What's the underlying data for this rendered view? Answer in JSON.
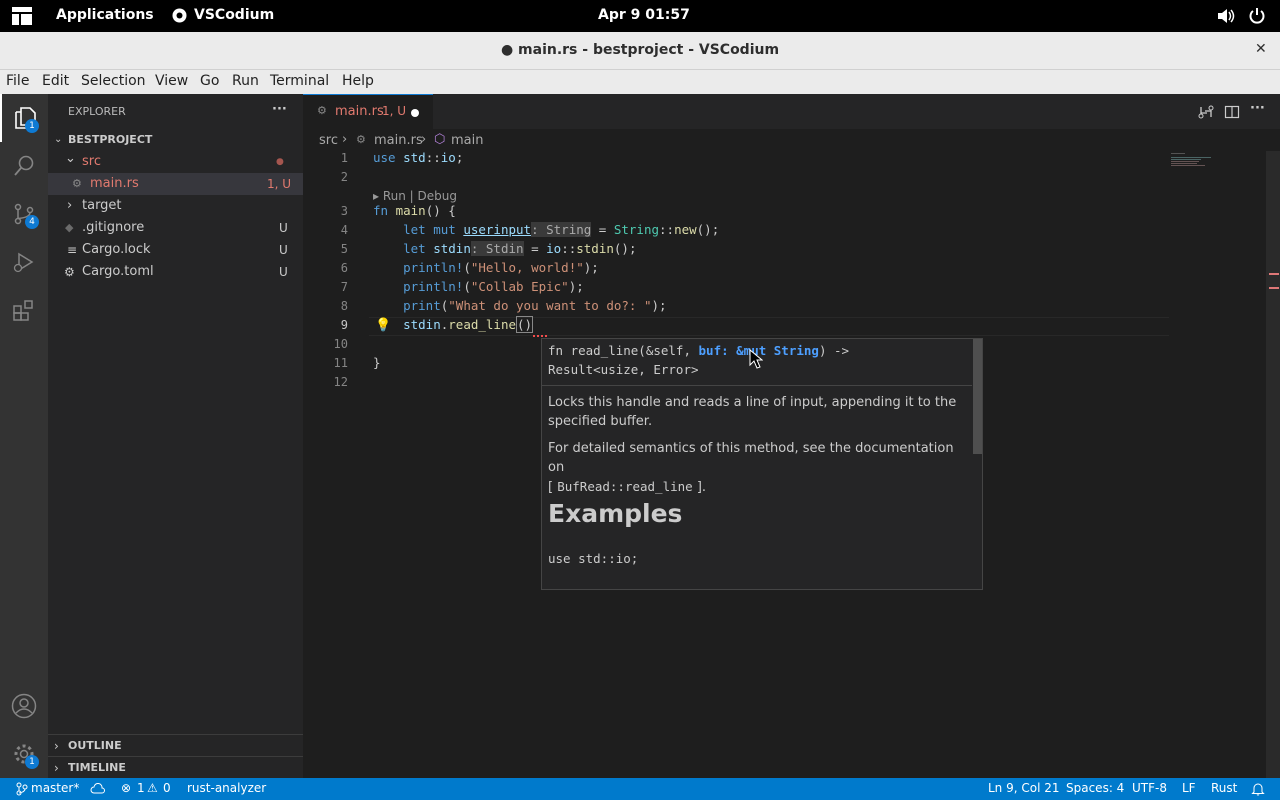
{
  "gnome": {
    "applications": "Applications",
    "app": "VSCodium",
    "clock": "Apr 9  01:57"
  },
  "window": {
    "title": "● main.rs - bestproject - VSCodium",
    "close": "✕"
  },
  "menu": [
    "File",
    "Edit",
    "Selection",
    "View",
    "Go",
    "Run",
    "Terminal",
    "Help"
  ],
  "activity": {
    "explorer_badge": "1",
    "scm_badge": "4",
    "settings_badge": "1"
  },
  "sidebar": {
    "header": "EXPLORER",
    "more": "···",
    "project": "BESTPROJECT",
    "items": [
      {
        "label": "src",
        "status": "●"
      },
      {
        "label": "main.rs",
        "status": "1, U"
      },
      {
        "label": "target",
        "status": ""
      },
      {
        "label": ".gitignore",
        "status": "U"
      },
      {
        "label": "Cargo.lock",
        "status": "U"
      },
      {
        "label": "Cargo.toml",
        "status": "U"
      }
    ],
    "outline": "OUTLINE",
    "timeline": "TIMELINE"
  },
  "tab": {
    "label": "main.rs",
    "status": "1, U"
  },
  "breadcrumb": {
    "src": "src",
    "file": "main.rs",
    "symbol": "main"
  },
  "codelens": "Run | Debug",
  "lines": [
    "1",
    "2",
    "3",
    "4",
    "5",
    "6",
    "7",
    "8",
    "9",
    "10",
    "11",
    "12"
  ],
  "hover": {
    "sig1": "fn read_line(&self, ",
    "sig_buf": "buf: &mut String",
    "sig2": ") ->",
    "sig3": "Result<usize, Error>",
    "p1": "Locks this handle and reads a line of input, appending it to the specified buffer.",
    "p2a": "For detailed semantics of this method, see the documentation on",
    "p2b": "[ ",
    "p2code": "BufRead::read_line",
    "p2c": " ].",
    "heading": "Examples",
    "example": "use std::io;"
  },
  "status": {
    "branch": "master*",
    "errors": "1",
    "warnings": "0",
    "server": "rust-analyzer",
    "position": "Ln 9, Col 21",
    "spaces": "Spaces: 4",
    "encoding": "UTF-8",
    "eol": "LF",
    "language": "Rust"
  },
  "colors": {
    "accent": "#007acc",
    "editor_bg": "#1e1e1e",
    "sidebar_bg": "#252526"
  }
}
